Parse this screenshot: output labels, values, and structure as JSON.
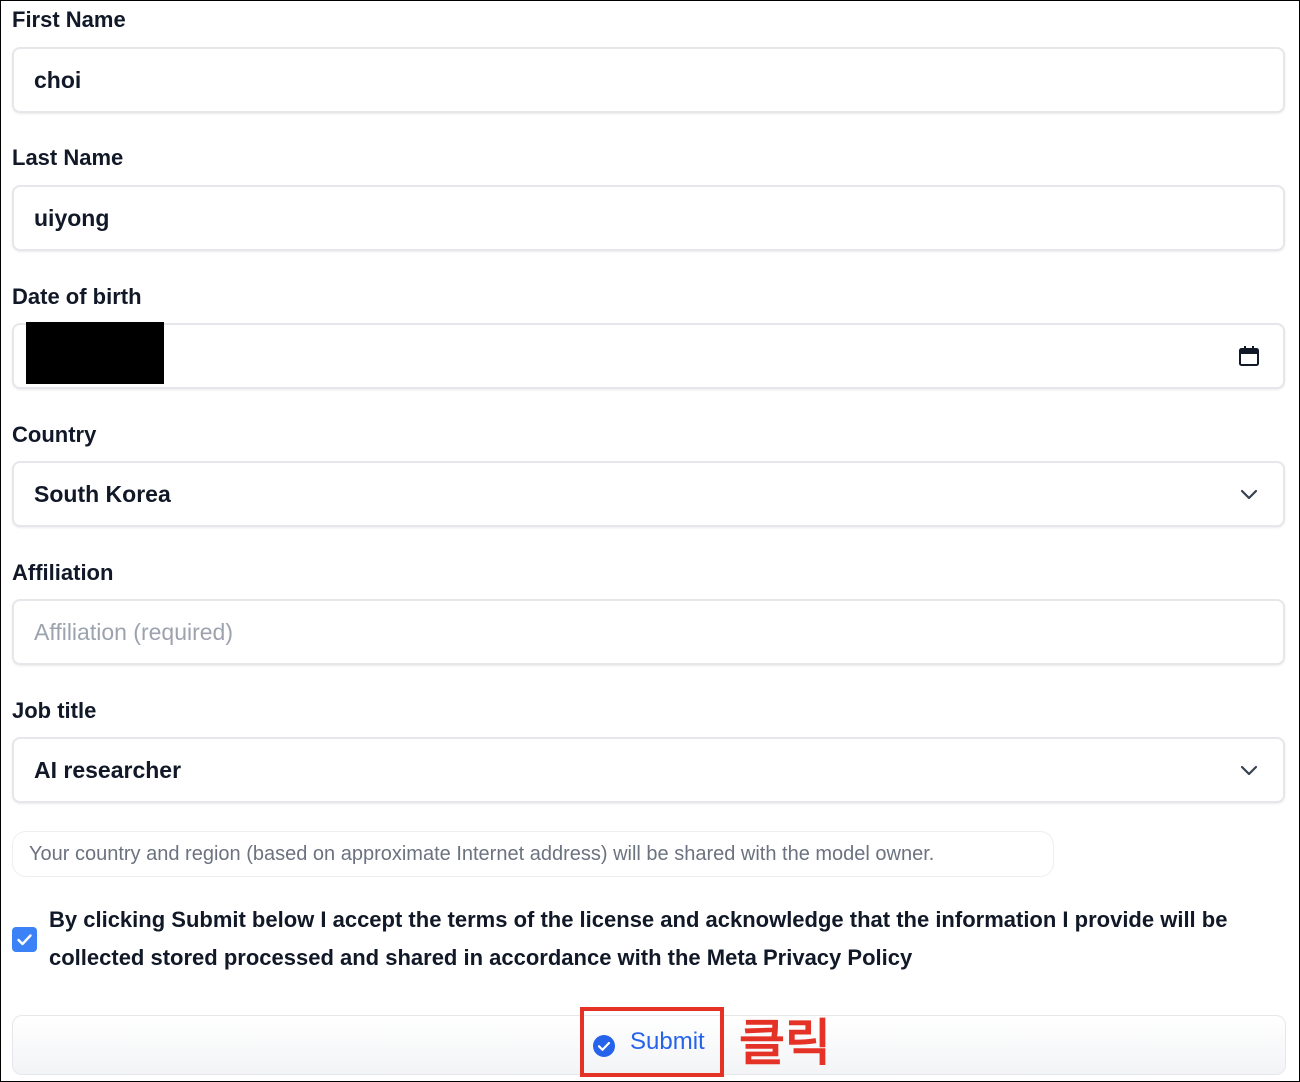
{
  "form": {
    "first_name": {
      "label": "First Name",
      "value": "choi"
    },
    "last_name": {
      "label": "Last Name",
      "value": "uiyong"
    },
    "date_of_birth": {
      "label": "Date of birth",
      "value": "",
      "icon": "calendar-icon"
    },
    "country": {
      "label": "Country",
      "value": "South Korea",
      "icon": "chevron-down-icon"
    },
    "affiliation": {
      "label": "Affiliation",
      "value": "",
      "placeholder": "Affiliation (required)"
    },
    "job_title": {
      "label": "Job title",
      "value": "AI researcher",
      "icon": "chevron-down-icon"
    },
    "notice": "Your country and region (based on approximate Internet address) will be shared with the model owner.",
    "consent": {
      "checked": true,
      "text": "By clicking Submit below I accept the terms of the license and acknowledge that the information I provide will be collected stored processed and shared in accordance with the Meta Privacy Policy"
    },
    "submit": {
      "label": "Submit",
      "icon": "check-circle-icon"
    }
  },
  "annotation": {
    "text": "클릭",
    "color": "#e53226"
  },
  "colors": {
    "accent": "#3b82f6",
    "submit_text": "#2563eb",
    "highlight": "#e53226",
    "placeholder": "#9ca3af"
  }
}
